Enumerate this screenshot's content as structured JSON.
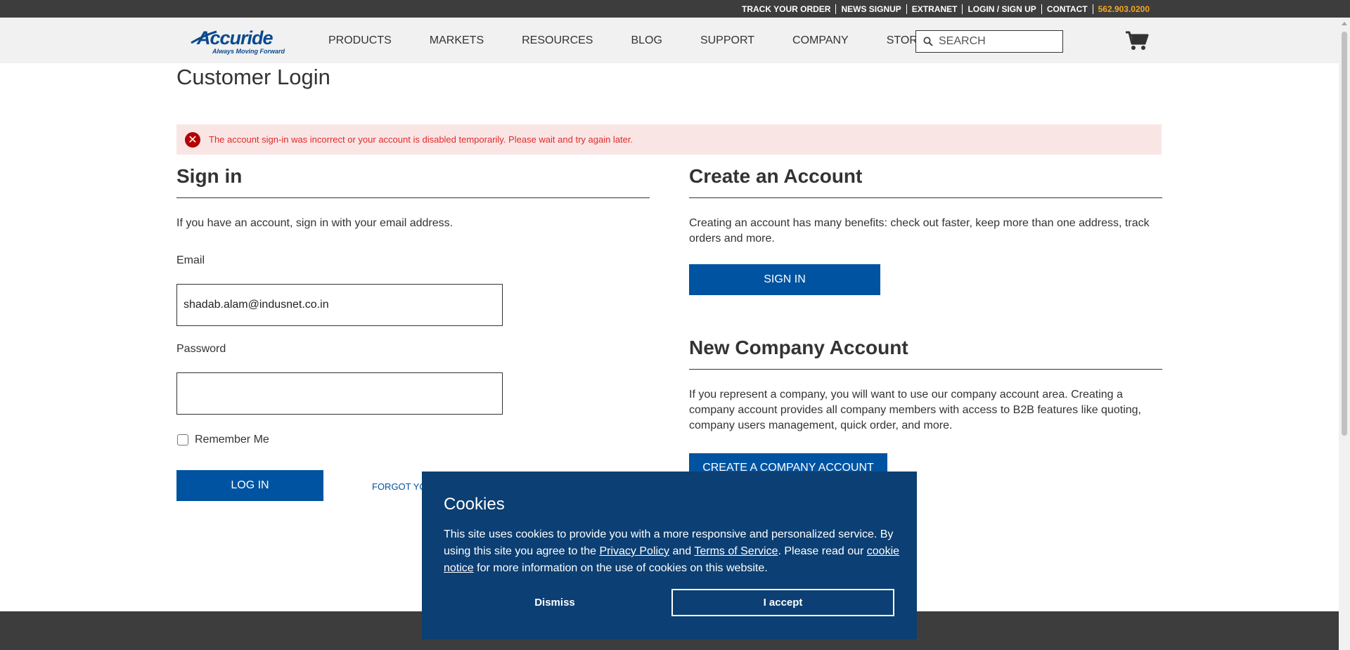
{
  "topbar": {
    "links": [
      "TRACK YOUR ORDER",
      "NEWS SIGNUP",
      "EXTRANET",
      "LOGIN / SIGN UP",
      "CONTACT"
    ],
    "phone": "562.903.0200"
  },
  "header": {
    "logo_text": "Accuride",
    "logo_tagline": "Always Moving Forward",
    "nav": [
      "PRODUCTS",
      "MARKETS",
      "RESOURCES",
      "BLOG",
      "SUPPORT",
      "COMPANY",
      "STORE"
    ],
    "search_placeholder": "SEARCH",
    "icons": {
      "search": "search-icon",
      "cart": "cart-icon"
    }
  },
  "page": {
    "title": "Customer Login",
    "error": "The account sign-in was incorrect or your account is disabled temporarily. Please wait and try again later."
  },
  "signin": {
    "heading": "Sign in",
    "intro": "If you have an account, sign in with your email address.",
    "email_label": "Email",
    "email_value": "shadab.alam@indusnet.co.in",
    "password_label": "Password",
    "password_value": "",
    "remember_label": "Remember Me",
    "login_button": "LOG IN",
    "forgot_link": "FORGOT YO"
  },
  "create_account": {
    "heading": "Create an Account",
    "intro": "Creating an account has many benefits: check out faster, keep more than one address, track orders and more.",
    "button": "SIGN IN"
  },
  "company_account": {
    "heading": "New Company Account",
    "intro": "If you represent a company, you will want to use our company account area. Creating a company account provides all company members with access to B2B features like quoting, company users management, quick order, and more.",
    "button": "CREATE A COMPANY ACCOUNT"
  },
  "cookies": {
    "title": "Cookies",
    "text_1": "This site uses cookies to provide you with a more responsive and personalized service. By using this site you agree to the ",
    "privacy_link": "Privacy Policy",
    "text_2": " and ",
    "terms_link": "Terms of Service",
    "text_3": ". Please read our ",
    "cookie_link": "cookie notice",
    "text_4": " for more information on the use of cookies on this website.",
    "dismiss": "Dismiss",
    "accept": "I accept"
  },
  "colors": {
    "primary": "#0053a0",
    "cookie_bg": "#0c3f73",
    "error_bg": "#fae5e5",
    "error_text": "#e02b27",
    "phone": "#f5a623"
  }
}
